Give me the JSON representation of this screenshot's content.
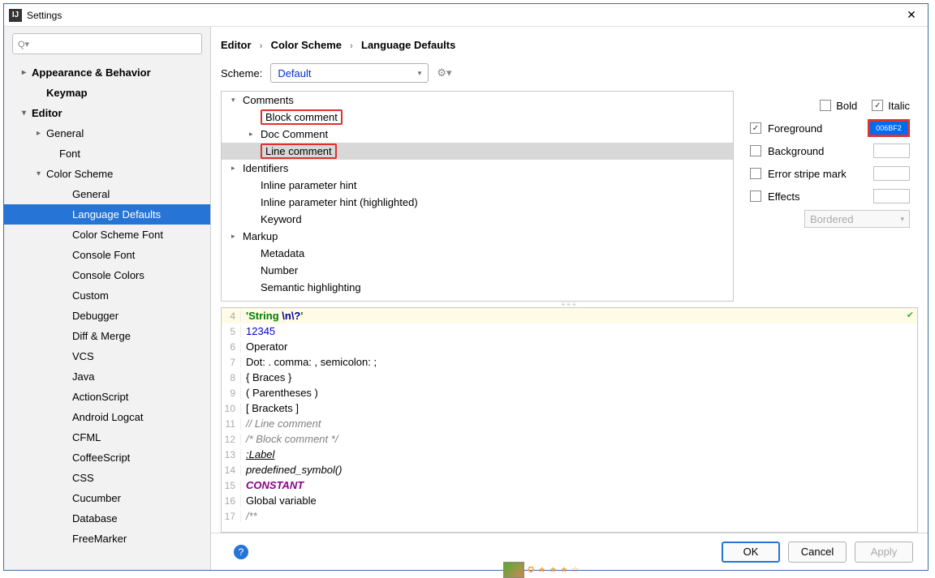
{
  "window": {
    "title": "Settings"
  },
  "breadcrumb": [
    "Editor",
    "Color Scheme",
    "Language Defaults"
  ],
  "scheme": {
    "label": "Scheme:",
    "value": "Default"
  },
  "sidebar": {
    "items": [
      {
        "label": "Appearance & Behavior",
        "bold": true,
        "chev": ">",
        "lvl": 1
      },
      {
        "label": "Keymap",
        "bold": true,
        "lvl": 2
      },
      {
        "label": "Editor",
        "bold": true,
        "chev": "v",
        "lvl": 1
      },
      {
        "label": "General",
        "chev": ">",
        "lvl": 2
      },
      {
        "label": "Font",
        "lvl": 3
      },
      {
        "label": "Color Scheme",
        "chev": "v",
        "lvl": 2
      },
      {
        "label": "General",
        "lvl": 4
      },
      {
        "label": "Language Defaults",
        "lvl": 4,
        "selected": true
      },
      {
        "label": "Color Scheme Font",
        "lvl": 4
      },
      {
        "label": "Console Font",
        "lvl": 4
      },
      {
        "label": "Console Colors",
        "lvl": 4
      },
      {
        "label": "Custom",
        "lvl": 4
      },
      {
        "label": "Debugger",
        "lvl": 4
      },
      {
        "label": "Diff & Merge",
        "lvl": 4
      },
      {
        "label": "VCS",
        "lvl": 4
      },
      {
        "label": "Java",
        "lvl": 4
      },
      {
        "label": "ActionScript",
        "lvl": 4
      },
      {
        "label": "Android Logcat",
        "lvl": 4
      },
      {
        "label": "CFML",
        "lvl": 4
      },
      {
        "label": "CoffeeScript",
        "lvl": 4
      },
      {
        "label": "CSS",
        "lvl": 4
      },
      {
        "label": "Cucumber",
        "lvl": 4
      },
      {
        "label": "Database",
        "lvl": 4
      },
      {
        "label": "FreeMarker",
        "lvl": 4
      }
    ]
  },
  "tree": [
    {
      "label": "Comments",
      "chev": "v",
      "lvl": 1
    },
    {
      "label": "Block comment",
      "lvl": 2,
      "red": true
    },
    {
      "label": "Doc Comment",
      "chev": ">",
      "lvl": 2
    },
    {
      "label": "Line comment",
      "lvl": 2,
      "red": true,
      "selected": true
    },
    {
      "label": "Identifiers",
      "chev": ">",
      "lvl": 1
    },
    {
      "label": "Inline parameter hint",
      "lvl": 2
    },
    {
      "label": "Inline parameter hint (highlighted)",
      "lvl": 2
    },
    {
      "label": "Keyword",
      "lvl": 2
    },
    {
      "label": "Markup",
      "chev": ">",
      "lvl": 1
    },
    {
      "label": "Metadata",
      "lvl": 2
    },
    {
      "label": "Number",
      "lvl": 2
    },
    {
      "label": "Semantic highlighting",
      "lvl": 2
    }
  ],
  "attrs": {
    "bold": "Bold",
    "italic": "Italic",
    "foreground": "Foreground",
    "fg_hex": "006BF2",
    "background": "Background",
    "error_stripe": "Error stripe mark",
    "effects": "Effects",
    "effects_type": "Bordered"
  },
  "preview": [
    {
      "n": 4,
      "cls": "hl-line",
      "html": "<span class='c-str'>'String </span><span class='c-esc'>\\n\\?</span><span class='c-str'>'</span>"
    },
    {
      "n": 5,
      "html": "<span class='c-num'>12345</span>"
    },
    {
      "n": 6,
      "html": "Operator"
    },
    {
      "n": 7,
      "html": "Dot: . comma: , semicolon: ;"
    },
    {
      "n": 8,
      "html": "{ Braces }"
    },
    {
      "n": 9,
      "html": "( Parentheses )"
    },
    {
      "n": 10,
      "html": "[ Brackets ]"
    },
    {
      "n": 11,
      "html": "<span class='c-cm'>// Line comment</span>"
    },
    {
      "n": 12,
      "html": "<span class='c-cm'>/* Block comment */</span>"
    },
    {
      "n": 13,
      "html": "<span class='c-lbl'>:Label</span>"
    },
    {
      "n": 14,
      "html": "<span class='c-pre'>predefined_symbol()</span>"
    },
    {
      "n": 15,
      "html": "<span class='c-const'>CONSTANT</span>"
    },
    {
      "n": 16,
      "html": "Global variable"
    },
    {
      "n": 17,
      "html": "<span class='c-cm'>/**</span>"
    }
  ],
  "buttons": {
    "ok": "OK",
    "cancel": "Cancel",
    "apply": "Apply"
  }
}
